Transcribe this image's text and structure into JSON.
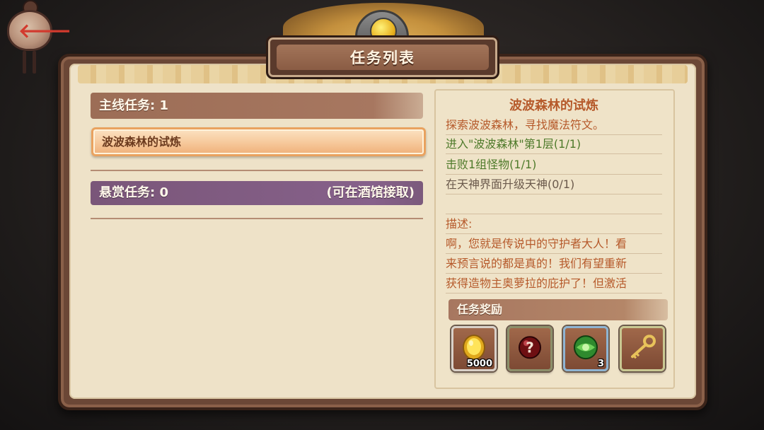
{
  "window": {
    "title": "任务列表"
  },
  "back": {
    "icon": "back-arrow-icon",
    "glyph": "🡐"
  },
  "left": {
    "main_header": "主线任务: 1",
    "main_quests": [
      {
        "label": "波波森林的试炼"
      }
    ],
    "bounty_header": "悬赏任务: 0",
    "bounty_hint": "(可在酒馆接取)"
  },
  "detail": {
    "title": "波波森林的试炼",
    "summary": "探索波波森林，寻找魔法符文。",
    "objectives": [
      {
        "text": "进入\"波波森林\"第1层(1/1)",
        "status": "done"
      },
      {
        "text": "击败1组怪物(1/1)",
        "status": "done"
      },
      {
        "text": "在天神界面升级天神(0/1)",
        "status": "pending"
      }
    ],
    "description_label": "描述:",
    "description_lines": [
      "啊，您就是传说中的守护者大人！看",
      "来预言说的都是真的！我们有望重新",
      "获得造物主奥萝拉的庇护了！但激活"
    ],
    "reward_header": "任务奖励",
    "rewards": [
      {
        "icon": "gold-coin-icon",
        "qty": "5000",
        "frame_color": "#d9d0c8"
      },
      {
        "icon": "mystery-orb-icon",
        "qty": "",
        "frame_color": "#8c8f6a"
      },
      {
        "icon": "green-gem-icon",
        "qty": "3",
        "frame_color": "#8fb4d2"
      },
      {
        "icon": "key-icon",
        "qty": "",
        "frame_color": "#c9c892"
      }
    ]
  },
  "colors": {
    "accent_orange": "#b65a2b",
    "done_green": "#4e7a2a",
    "bounty_purple": "#7a5679",
    "frame_brown": "#6b4736"
  }
}
